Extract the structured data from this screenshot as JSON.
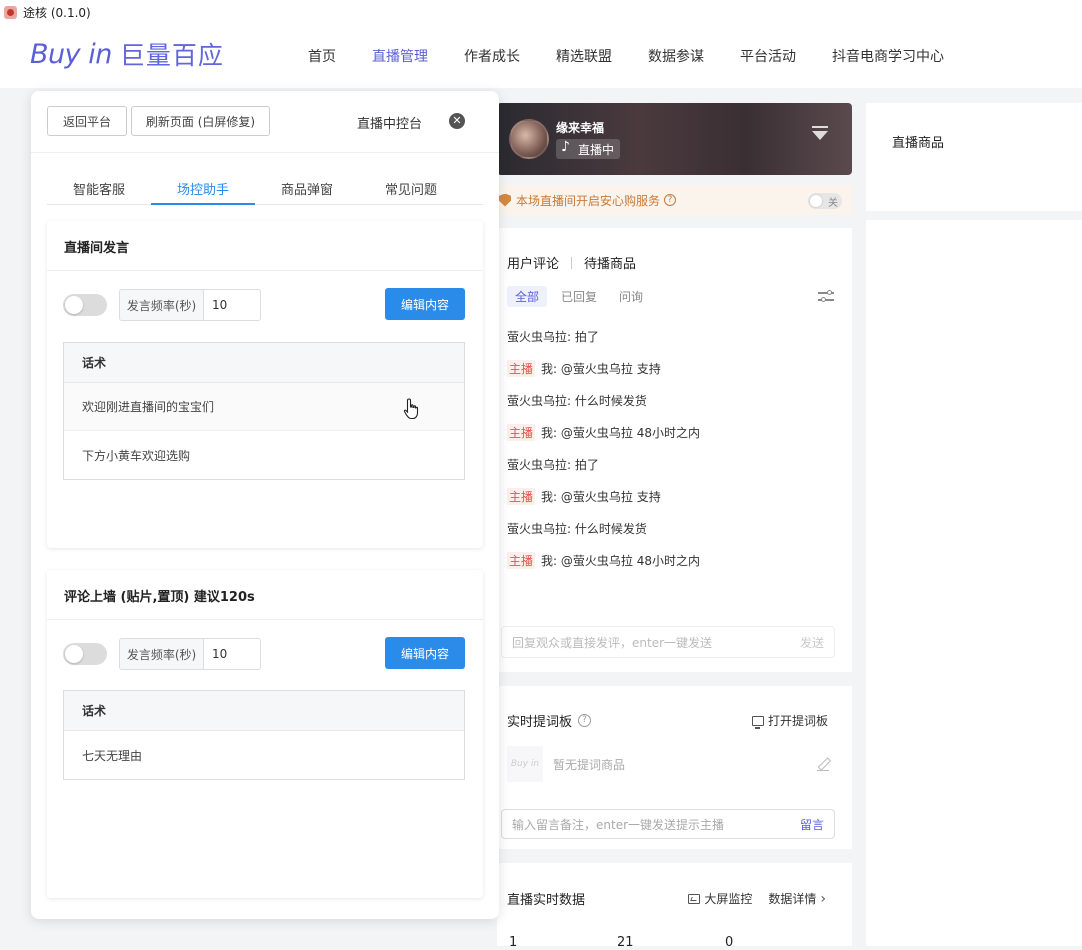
{
  "window": {
    "title": "途核 (0.1.0)"
  },
  "nav": {
    "logo_en": "Buy in",
    "logo_cn": "巨量百应",
    "items": [
      "首页",
      "直播管理",
      "作者成长",
      "精选联盟",
      "数据参谋",
      "平台活动",
      "抖音电商学习中心"
    ],
    "active_index": 1
  },
  "live": {
    "name": "缘来幸福",
    "status": "直播中",
    "safe_notice": "本场直播间开启安心购服务",
    "safe_toggle": "关"
  },
  "comments": {
    "tabs": [
      "用户评论",
      "待播商品"
    ],
    "filters": [
      "全部",
      "已回复",
      "问询"
    ],
    "host_tag": "主播",
    "items": [
      {
        "host": false,
        "text": "萤火虫乌拉: 拍了"
      },
      {
        "host": true,
        "text": "我: @萤火虫乌拉 支持"
      },
      {
        "host": false,
        "text": "萤火虫乌拉: 什么时候发货"
      },
      {
        "host": true,
        "text": "我: @萤火虫乌拉 48小时之内"
      },
      {
        "host": false,
        "text": "萤火虫乌拉: 拍了"
      },
      {
        "host": true,
        "text": "我: @萤火虫乌拉 支持"
      },
      {
        "host": false,
        "text": "萤火虫乌拉: 什么时候发货"
      },
      {
        "host": true,
        "text": "我: @萤火虫乌拉 48小时之内"
      }
    ],
    "reply_placeholder": "回复观众或直接发评，enter一键发送",
    "send_label": "发送"
  },
  "prompt": {
    "title": "实时提词板",
    "open_label": "打开提词板",
    "mini_logo": "Buy in",
    "empty_text": "暂无提词商品",
    "note_placeholder": "输入留言备注，enter一键发送提示主播",
    "note_button": "留言"
  },
  "live_data": {
    "title": "直播实时数据",
    "screen_label": "大屏监控",
    "detail_label": "数据详情",
    "numbers": [
      "1",
      "21",
      "0"
    ]
  },
  "goods": {
    "title": "直播商品"
  },
  "panel": {
    "back_button": "返回平台",
    "refresh_button": "刷新页面 (白屏修复)",
    "title": "直播中控台",
    "tabs": [
      "智能客服",
      "场控助手",
      "商品弹窗",
      "常见问题"
    ],
    "active_tab": 1,
    "sections": [
      {
        "title": "直播间发言",
        "freq_label": "发言频率(秒)",
        "freq_value": "10",
        "edit_button": "编辑内容",
        "table_header": "话术",
        "rows": [
          "欢迎刚进直播间的宝宝们",
          "下方小黄车欢迎选购"
        ]
      },
      {
        "title": "评论上墙 (贴片,置顶) 建议120s",
        "freq_label": "发言频率(秒)",
        "freq_value": "10",
        "edit_button": "编辑内容",
        "table_header": "话术",
        "rows": [
          "七天无理由"
        ]
      }
    ]
  },
  "colors": {
    "brand": "#5b5fd6",
    "primary": "#2b8be8",
    "host": "#e0564a",
    "warning": "#c87a3a"
  }
}
